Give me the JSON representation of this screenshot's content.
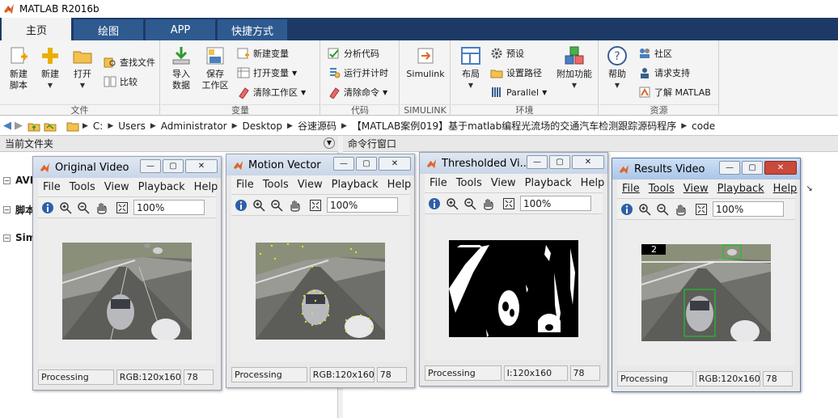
{
  "window": {
    "title": "MATLAB R2016b"
  },
  "tabs": [
    {
      "label": "主页",
      "active": true
    },
    {
      "label": "绘图",
      "active": false
    },
    {
      "label": "APP",
      "active": false
    },
    {
      "label": "快捷方式",
      "active": false
    }
  ],
  "ribbon": {
    "file": {
      "label": "文件",
      "new_script": "新建\n脚本",
      "new": "新建",
      "open": "打开",
      "find_files": "查找文件",
      "compare": "比较"
    },
    "variable": {
      "label": "变量",
      "import": "导入\n数据",
      "save_ws": "保存\n工作区",
      "new_var": "新建变量",
      "open_var": "打开变量",
      "clear_ws": "清除工作区"
    },
    "code": {
      "label": "代码",
      "analyze": "分析代码",
      "run_time": "运行并计时",
      "clear_cmd": "清除命令"
    },
    "simulink": {
      "label": "SIMULINK",
      "simulink": "Simulink"
    },
    "env": {
      "label": "环境",
      "layout": "布局",
      "prefs": "预设",
      "set_path": "设置路径",
      "parallel": "Parallel",
      "addons": "附加功能"
    },
    "resources": {
      "label": "资源",
      "help": "帮助",
      "community": "社区",
      "support": "请求支持",
      "learn": "了解 MATLAB"
    }
  },
  "address": {
    "crumbs": [
      "C:",
      "Users",
      "Administrator",
      "Desktop",
      "谷速源码",
      "【MATLAB案例019】基于matlab编程光流场的交通汽车检测跟踪源码程序",
      "code"
    ]
  },
  "panels": {
    "current_folder": "当前文件夹",
    "command_window": "命令行窗口",
    "tree": [
      "AVI",
      "脚本",
      "Sim"
    ]
  },
  "menus": [
    "File",
    "Tools",
    "View",
    "Playback",
    "Help"
  ],
  "zoom": "100%",
  "figures": [
    {
      "title": "Original Video",
      "status": "Processing",
      "info": "RGB:120x160",
      "frame": "78"
    },
    {
      "title": "Motion Vector",
      "status": "Processing",
      "info": "RGB:120x160",
      "frame": "78"
    },
    {
      "title": "Thresholded Vi...",
      "status": "Processing",
      "info": "I:120x160",
      "frame": "78"
    },
    {
      "title": "Results Video",
      "status": "Processing",
      "info": "RGB:120x160",
      "frame": "78",
      "count": "2"
    }
  ],
  "colors": {
    "tab_bar": "#1d3a66",
    "tab": "#2e5a8f",
    "box_green": "#22c02a",
    "motion_yellow": "#e8e020"
  }
}
